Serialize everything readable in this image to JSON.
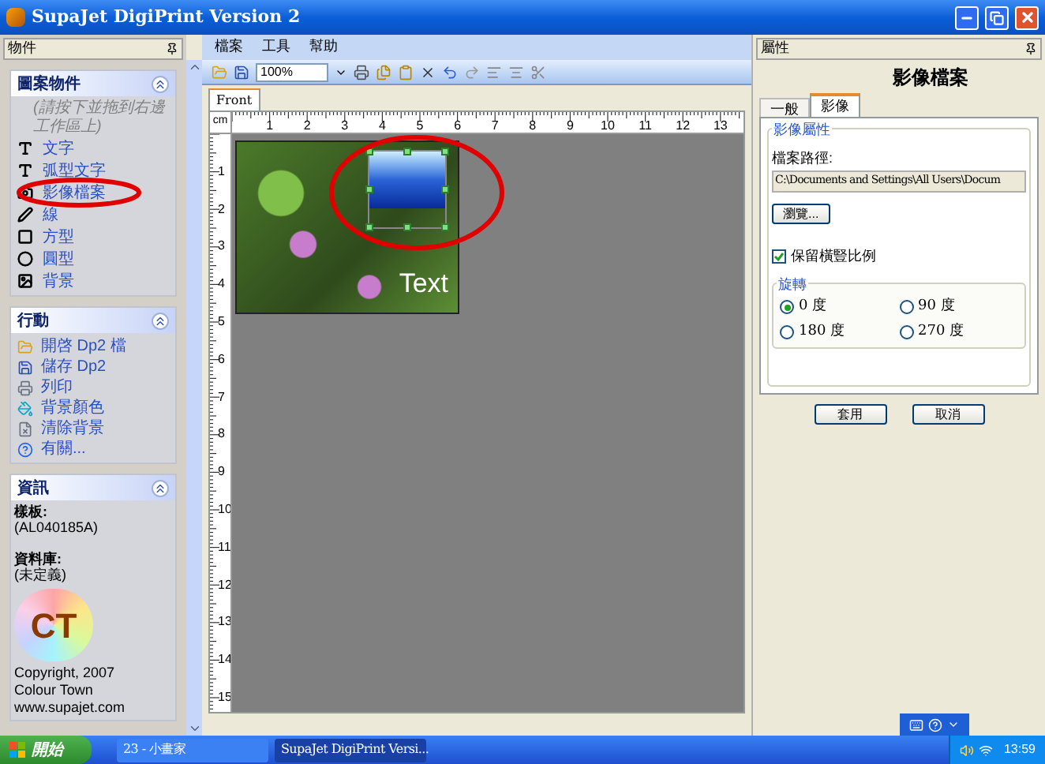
{
  "window": {
    "title": "SupaJet DigiPrint Version 2"
  },
  "left_panel": {
    "title": "物件",
    "sections": [
      {
        "kind": "objects",
        "title": "圖案物件",
        "expanded": true,
        "hint": "(請按下並拖到右邊工作區上)",
        "items": [
          "文字",
          "弧型文字",
          "影像檔案",
          "線",
          "方型",
          "圓型",
          "背景"
        ]
      },
      {
        "kind": "actions",
        "title": "行動",
        "expanded": true,
        "items": [
          "開啓 Dp2 檔",
          "儲存 Dp2",
          "列印",
          "背景顏色",
          "清除背景",
          "有關..."
        ]
      },
      {
        "kind": "info",
        "title": "資訊",
        "expanded": true,
        "fields": [
          {
            "label": "樣板:",
            "value": "(AL040185A)"
          },
          {
            "label": "資料庫:",
            "value": "(未定義)"
          }
        ],
        "logo_text": "CT",
        "credits": [
          "Copyright, 2007",
          "Colour Town",
          "www.supajet.com"
        ]
      }
    ]
  },
  "menu": [
    "檔案",
    "工具",
    "幫助"
  ],
  "toolbar": {
    "zoom": "100%"
  },
  "doc_tabs": [
    {
      "label": "Front",
      "selected": true
    }
  ],
  "ruler": {
    "unit": "cm",
    "h_labels": [
      "1",
      "2",
      "3",
      "4",
      "5",
      "6",
      "7",
      "8",
      "9",
      "10",
      "11",
      "12",
      "13"
    ],
    "v_labels": [
      "1",
      "2",
      "3",
      "4",
      "5",
      "6",
      "7",
      "8",
      "9",
      "10",
      "11",
      "12",
      "13",
      "14",
      "15"
    ]
  },
  "canvas": {
    "text": "Text"
  },
  "properties": {
    "title": "屬性",
    "heading": "影像檔案",
    "tabs": [
      {
        "label": "一般",
        "selected": false
      },
      {
        "label": "影像",
        "selected": true
      }
    ],
    "group_title": "影像屬性",
    "path_label": "檔案路徑:",
    "path_value": "C:\\Documents and Settings\\All Users\\Docum",
    "browse": "瀏覽...",
    "keep_ratio": {
      "label": "保留橫豎比例",
      "checked": true
    },
    "rotation": {
      "title": "旋轉",
      "options": [
        {
          "label": "0 度",
          "selected": true
        },
        {
          "label": "90 度",
          "selected": false
        },
        {
          "label": "180 度",
          "selected": false
        },
        {
          "label": "270 度",
          "selected": false
        }
      ]
    },
    "buttons": [
      "套用",
      "取消"
    ]
  },
  "taskbar": {
    "start": "開始",
    "tasks": [
      {
        "label": "23 - 小畫家",
        "selected": false
      },
      {
        "label": "SupaJet DigiPrint Versi...",
        "selected": true
      }
    ],
    "clock": "13:59"
  }
}
